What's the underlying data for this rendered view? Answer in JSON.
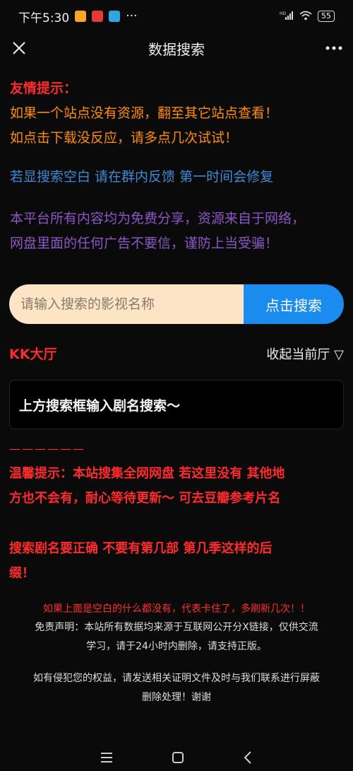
{
  "status_bar": {
    "time": "下午5:30",
    "dots": "···",
    "network": "HD",
    "battery": "55"
  },
  "nav": {
    "title": "数据搜索"
  },
  "notice": {
    "title": "友情提示：",
    "line1": "如果一个站点没有资源，翻至其它站点查看！",
    "line2": "如点击下载没反应，请多点几次试试！",
    "blue_line": "若显搜索空白 请在群内反馈 第一时间会修复",
    "purple_line1": "本平台所有内容均为免费分享，资源来自于网络，",
    "purple_line2": "网盘里面的任何广告不要信，谨防上当受骗！"
  },
  "search": {
    "placeholder": "请输入搜索的影视名称",
    "button": "点击搜索"
  },
  "hall": {
    "title": "KK大厅",
    "collapse": "收起当前厅 ▽"
  },
  "hint_card": "上方搜索框输入剧名搜索〜",
  "divider": "——————",
  "warnings": {
    "line1": "温馨提示：本站搜集全网网盘 若这里没有 其他地",
    "line2": "方也不会有，耐心等待更新〜 可去豆瓣参考片名",
    "line3": "搜索剧名要正确 不要有第几部 第几季这样的后",
    "line4": "缀！"
  },
  "footer": {
    "refresh_hint": "如果上面是空白的什么都没有，代表卡住了，多刷新几次！！",
    "disclaimer_line1": "免责声明：本站所有数据均来源于互联网公开分X链接，仅供交流",
    "disclaimer_line2": "学习，请于24小时内删除，请支持正版。",
    "infringe_line1": "如有侵犯您的权益，请发送相关证明文件及时与我们联系进行屏蔽",
    "infringe_line2": "删除处理！谢谢"
  },
  "colors": {
    "orange": "#ff8c00",
    "red": "#ff2a2a",
    "blue": "#3a8ad6",
    "purple": "#8b57c6",
    "search_button": "#1a8cf0",
    "search_input": "#fce4c4"
  },
  "icons": [
    "close-icon",
    "more-icon",
    "wifi-icon",
    "signal-icon",
    "battery-icon",
    "menu-icon",
    "home-icon",
    "back-icon"
  ]
}
